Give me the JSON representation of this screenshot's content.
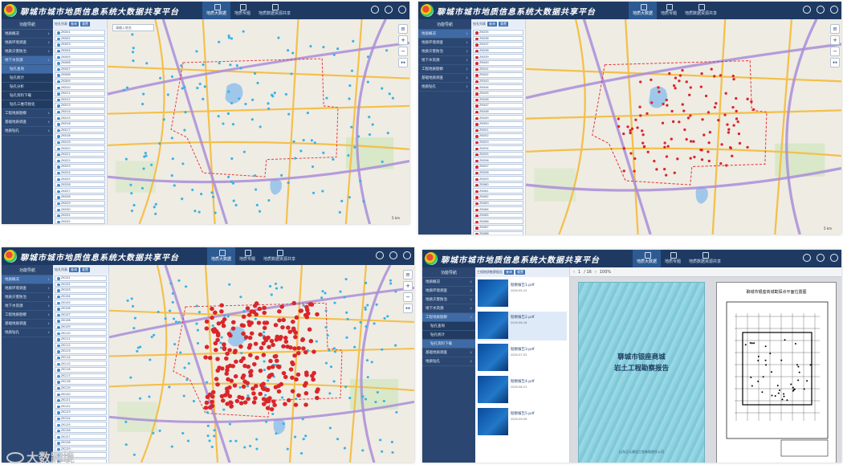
{
  "platform_title": "聊城市城市地质信息系统大数据共享平台",
  "tabs": [
    "地质大数据",
    "地质专题",
    "地质数据资源共享"
  ],
  "sidebar": {
    "header": "功能导航",
    "items": [
      "地质概况",
      "地质环境调查",
      "地质灾害防治",
      "地下水资源",
      "工程地质勘察",
      "基础地质调查",
      "地质钻孔"
    ],
    "sub_items": [
      "钻孔查询",
      "钻孔统计",
      "钻孔分析",
      "钻孔资料下载",
      "钻孔三维可视化"
    ]
  },
  "list_head": {
    "label": "钻孔列表",
    "search_btn": "查询",
    "reset_btn": "重置"
  },
  "map": {
    "search_placeholder": "请输入地名",
    "scale": "5 km"
  },
  "panel1_rows": [
    "ZK001",
    "ZK002",
    "ZK003",
    "ZK004",
    "ZK005",
    "ZK006",
    "ZK007",
    "ZK008",
    "ZK009",
    "ZK010",
    "ZK011",
    "ZK012",
    "ZK013",
    "ZK014",
    "ZK015",
    "ZK016",
    "ZK017",
    "ZK018",
    "ZK019",
    "ZK020",
    "ZK021",
    "ZK022",
    "ZK023",
    "ZK024",
    "ZK025",
    "ZK026",
    "ZK027",
    "ZK028",
    "ZK029",
    "ZK030",
    "ZK031",
    "ZK032",
    "ZK033",
    "ZK034"
  ],
  "panel2_rows": [
    "ZK035",
    "ZK036",
    "ZK037",
    "ZK038",
    "ZK039",
    "ZK040",
    "ZK041",
    "ZK042",
    "ZK043",
    "ZK044",
    "ZK045",
    "ZK046",
    "ZK047",
    "ZK048",
    "ZK049",
    "ZK050",
    "ZK051",
    "ZK052",
    "ZK053",
    "ZK054",
    "ZK055",
    "ZK056",
    "ZK057",
    "ZK058",
    "ZK059",
    "ZK060",
    "ZK061",
    "ZK062",
    "ZK063",
    "ZK064",
    "ZK065",
    "ZK066",
    "ZK067",
    "ZK068",
    "ZK069",
    "ZK070"
  ],
  "panel3_rows": [
    "ZK101",
    "ZK102",
    "ZK103",
    "ZK104",
    "ZK105",
    "ZK106",
    "ZK107",
    "ZK108",
    "ZK109",
    "ZK110",
    "ZK111",
    "ZK112",
    "ZK113",
    "ZK114",
    "ZK115",
    "ZK116",
    "ZK117",
    "ZK118",
    "ZK119",
    "ZK120",
    "ZK121",
    "ZK122",
    "ZK123",
    "ZK124",
    "ZK125",
    "ZK126",
    "ZK127",
    "ZK128",
    "ZK129",
    "ZK130",
    "ZK131",
    "ZK132",
    "ZK133",
    "ZK134"
  ],
  "docs": {
    "head": "工程地质勘察报告",
    "cards": [
      {
        "title": "勘察报告1.pdf",
        "meta": "2020-05-12"
      },
      {
        "title": "勘察报告2.pdf",
        "meta": "2020-06-18"
      },
      {
        "title": "勘察报告3.pdf",
        "meta": "2020-07-02"
      },
      {
        "title": "勘察报告4.pdf",
        "meta": "2020-08-21"
      },
      {
        "title": "勘察报告5.pdf",
        "meta": "2020-09-09"
      }
    ]
  },
  "viewer": {
    "page": "1",
    "total": "/ 16",
    "zoom": "100%"
  },
  "cover": {
    "title_line1": "聊城市银座商城",
    "title_line2": "岩土工程勘察报告",
    "footer": "山东正元建设工程有限责任公司"
  },
  "drawing": {
    "title": "聊城市银座商城勘探点平面位置图"
  },
  "watermark": "大数跨境",
  "colors": {
    "header": "#1f3a62",
    "sidebar": "#2b4771",
    "road": "#f3c04b",
    "highway": "#a98ed8",
    "boundary": "#e03b3b"
  }
}
